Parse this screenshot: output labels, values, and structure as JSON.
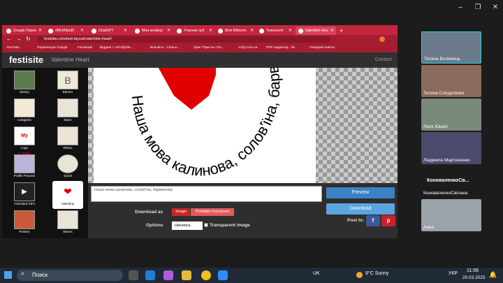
{
  "window": {
    "minimize": "–",
    "maximize": "❐",
    "close": "✕"
  },
  "browser": {
    "tabs": [
      {
        "label": "Google Перек"
      },
      {
        "label": "d0fcd0bed0"
      },
      {
        "label": "ChatGPT"
      },
      {
        "label": "Мои конфер"
      },
      {
        "label": "Учасник пуб"
      },
      {
        "label": "Моя бiблiоте"
      },
      {
        "label": "Технологiї"
      },
      {
        "label": "Valentine Hea"
      }
    ],
    "url": "festisite.com/text-layout/valentine-heart/",
    "bookmarks": [
      "YouTube",
      "Переклацач Google",
      "Facebook",
      "Віддені + v474@ukr...",
      "Всесвіта - Сіяльн...",
      "Урок \"Притча «По...",
      "Vchy.com.ua",
      "PDF-редактор - бе...",
      "Освідомі освітні..."
    ]
  },
  "site": {
    "logo": "festisite",
    "page_title": "Valentine Heart",
    "contact": "Contact",
    "nav_items": [
      {
        "label": "Money"
      },
      {
        "label": "Banner"
      },
      {
        "label": "Cartgame"
      },
      {
        "label": "Maze"
      },
      {
        "label": "Logo"
      },
      {
        "label": "Rebus"
      },
      {
        "label": "Profile Pictures"
      },
      {
        "label": "Spiral"
      },
      {
        "label": "Animated GIFs"
      },
      {
        "label": "Valentine"
      },
      {
        "label": "Posters"
      },
      {
        "label": "Waves"
      }
    ],
    "logo_thumb": "My Logo",
    "curved_text": "Наша мова калинова, солов'їна, барвінкова",
    "textarea_value": "Наша мова калинова, солов'їна, барвінкова",
    "preview": "Preview",
    "download": "Download",
    "download_as": "Download as",
    "image": "Image",
    "printable": "Printable Document",
    "options": "Options",
    "font": "Helvetica",
    "transparent": "Transparent image",
    "post_to": "Post to:",
    "fb": "f",
    "pin": "p"
  },
  "meeting": {
    "participants": [
      {
        "name": "Тетяна Волинець"
      },
      {
        "name": "Тетяна Солдатенко"
      },
      {
        "name": "Леся Юшко"
      },
      {
        "name": "Людмила Мартиненко"
      },
      {
        "name": "КоноваленкоСв...",
        "subname": "КоноваленкоСвiлана"
      },
      {
        "name": "Анна"
      }
    ]
  },
  "taskbar": {
    "search": "Поиск",
    "lang_badge": "UK",
    "weather": "9°C  Sunny",
    "lang": "УКР",
    "time": "11:56",
    "date": "20.03.2025"
  },
  "colors": {
    "accent": "#c2273d",
    "heart": "#e00000",
    "preview_btn": "#3b82c4",
    "download_btn": "#5ba4e0"
  }
}
